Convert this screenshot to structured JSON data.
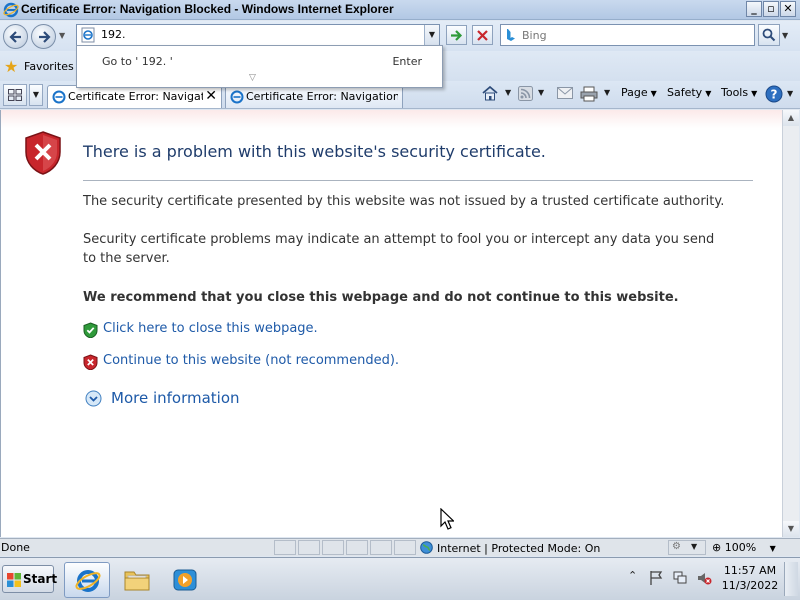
{
  "window": {
    "title": "Certificate Error: Navigation Blocked - Windows Internet Explorer",
    "minimize": "_",
    "maximize": "▫",
    "close": "✕"
  },
  "address_bar": {
    "url": "192.",
    "search_placeholder": "Bing"
  },
  "autocomplete": {
    "suggestion": "Go to ' 192. '",
    "enter_label": "Enter"
  },
  "favorites": {
    "label": "Favorites"
  },
  "tabs": [
    {
      "title": "Certificate Error: Navigat...",
      "active": true
    },
    {
      "title": "Certificate Error: Navigation ...",
      "active": false
    }
  ],
  "command_bar": {
    "page": "Page",
    "safety": "Safety",
    "tools": "Tools"
  },
  "content": {
    "heading": "There is a problem with this website's security certificate.",
    "paragraph1": "The security certificate presented by this website was not issued by a trusted certificate authority.",
    "paragraph2": "Security certificate problems may indicate an attempt to fool you or intercept any data you send to the server.",
    "recommendation": "We recommend that you close this webpage and do not continue to this website.",
    "close_link": "Click here to close this webpage.",
    "continue_link": "Continue to this website (not recommended).",
    "more_info": "More information"
  },
  "status_bar": {
    "status": "Done",
    "zone": "Internet | Protected Mode: On",
    "zoom": "100%"
  },
  "taskbar": {
    "start": "Start",
    "time": "11:57 AM",
    "date": "11/3/2022"
  },
  "colors": {
    "link": "#1e5aa8",
    "heading": "#1f3c6b",
    "error_red": "#c8262c",
    "ok_green": "#2f9a3a"
  }
}
